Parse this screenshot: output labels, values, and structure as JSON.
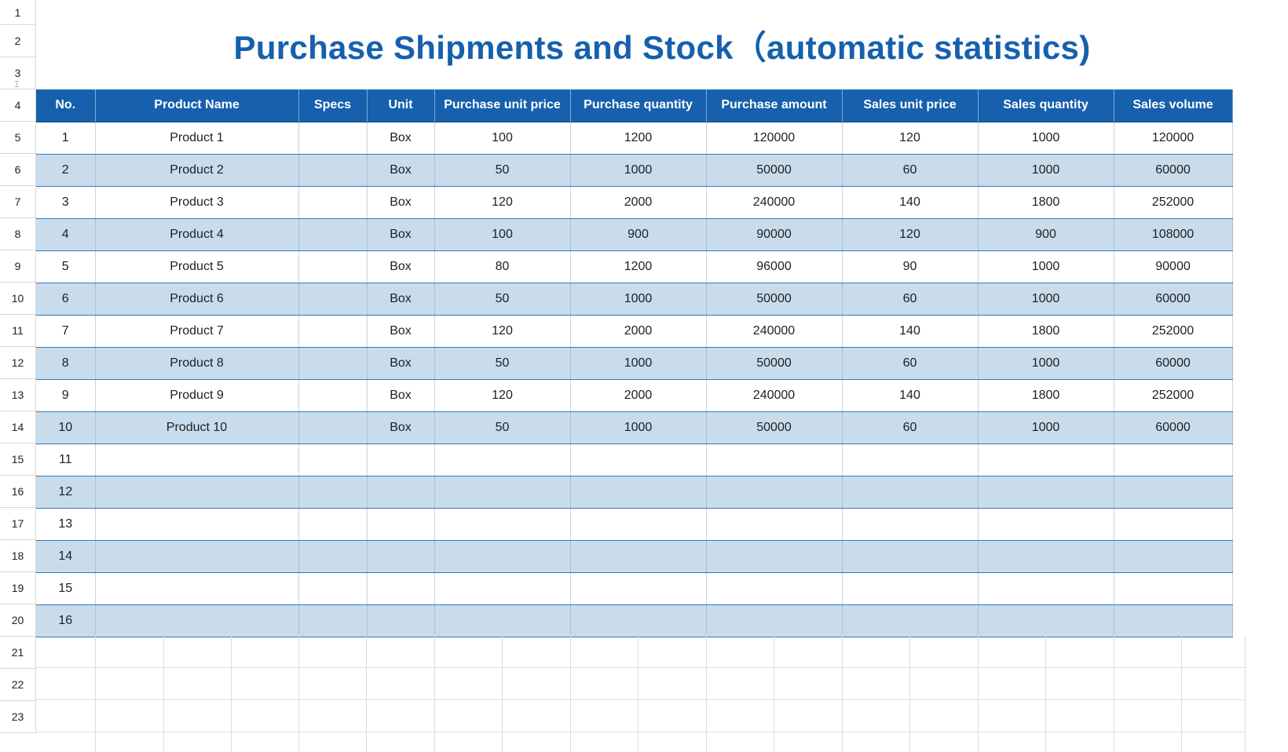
{
  "title": "Purchase Shipments and Stock（automatic statistics)",
  "row_numbers": [
    "1",
    "2",
    "3",
    "4",
    "5",
    "6",
    "7",
    "8",
    "9",
    "10",
    "11",
    "12",
    "13",
    "14",
    "15",
    "16",
    "17",
    "18",
    "19",
    "20",
    "21",
    "22",
    "23"
  ],
  "columns": [
    "No.",
    "Product Name",
    "Specs",
    "Unit",
    "Purchase unit price",
    "Purchase quantity",
    "Purchase amount",
    "Sales unit price",
    "Sales quantity",
    "Sales volume"
  ],
  "rows": [
    [
      "1",
      "Product 1",
      "",
      "Box",
      "100",
      "1200",
      "120000",
      "120",
      "1000",
      "120000"
    ],
    [
      "2",
      "Product 2",
      "",
      "Box",
      "50",
      "1000",
      "50000",
      "60",
      "1000",
      "60000"
    ],
    [
      "3",
      "Product 3",
      "",
      "Box",
      "120",
      "2000",
      "240000",
      "140",
      "1800",
      "252000"
    ],
    [
      "4",
      "Product 4",
      "",
      "Box",
      "100",
      "900",
      "90000",
      "120",
      "900",
      "108000"
    ],
    [
      "5",
      "Product 5",
      "",
      "Box",
      "80",
      "1200",
      "96000",
      "90",
      "1000",
      "90000"
    ],
    [
      "6",
      "Product 6",
      "",
      "Box",
      "50",
      "1000",
      "50000",
      "60",
      "1000",
      "60000"
    ],
    [
      "7",
      "Product 7",
      "",
      "Box",
      "120",
      "2000",
      "240000",
      "140",
      "1800",
      "252000"
    ],
    [
      "8",
      "Product 8",
      "",
      "Box",
      "50",
      "1000",
      "50000",
      "60",
      "1000",
      "60000"
    ],
    [
      "9",
      "Product 9",
      "",
      "Box",
      "120",
      "2000",
      "240000",
      "140",
      "1800",
      "252000"
    ],
    [
      "10",
      "Product 10",
      "",
      "Box",
      "50",
      "1000",
      "50000",
      "60",
      "1000",
      "60000"
    ],
    [
      "11",
      "",
      "",
      "",
      "",
      "",
      "",
      "",
      "",
      ""
    ],
    [
      "12",
      "",
      "",
      "",
      "",
      "",
      "",
      "",
      "",
      ""
    ],
    [
      "13",
      "",
      "",
      "",
      "",
      "",
      "",
      "",
      "",
      ""
    ],
    [
      "14",
      "",
      "",
      "",
      "",
      "",
      "",
      "",
      "",
      ""
    ],
    [
      "15",
      "",
      "",
      "",
      "",
      "",
      "",
      "",
      "",
      ""
    ],
    [
      "16",
      "",
      "",
      "",
      "",
      "",
      "",
      "",
      "",
      ""
    ]
  ],
  "colors": {
    "header_bg": "#1660ad",
    "title": "#1660ad",
    "band": "#c8dcec"
  },
  "icons": {
    "row_resize": "row-resize-icon"
  }
}
